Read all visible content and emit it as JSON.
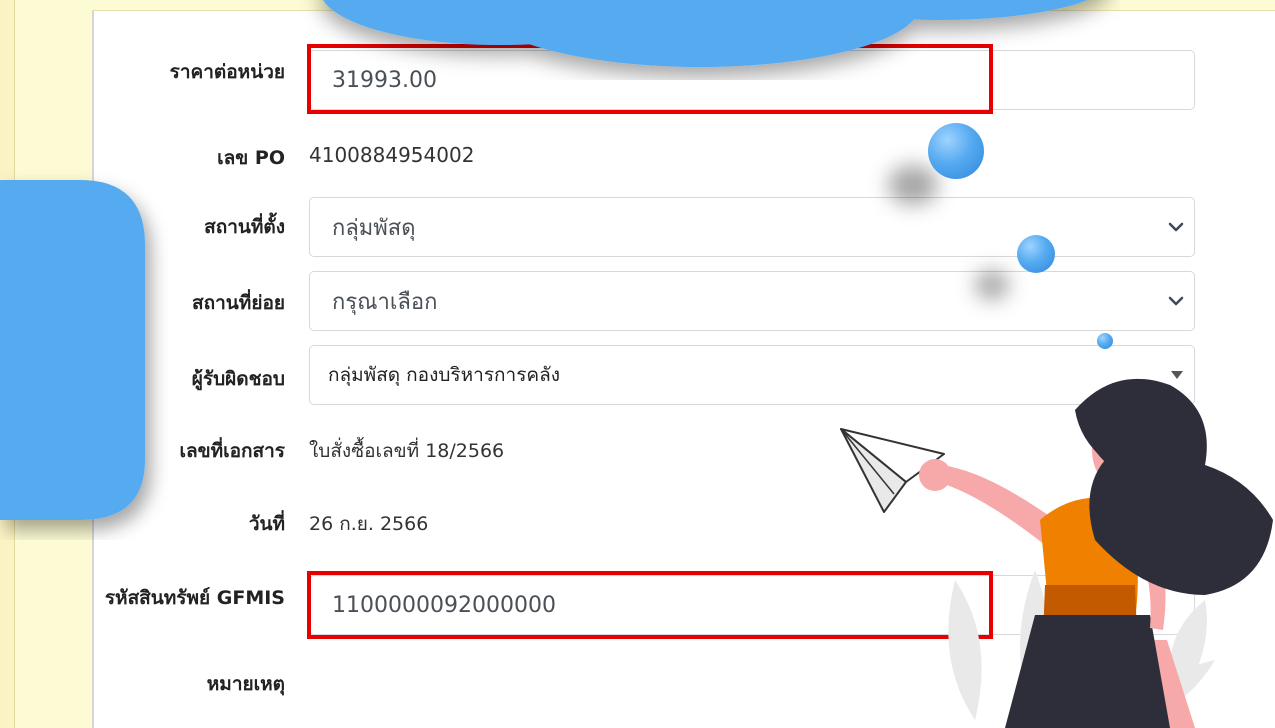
{
  "form": {
    "unit_price": {
      "label": "ราคาต่อหน่วย",
      "value": "31993.00"
    },
    "po_number": {
      "label": "เลข PO",
      "value": "4100884954002"
    },
    "location": {
      "label": "สถานที่ตั้ง",
      "value": "กลุ่มพัสดุ"
    },
    "sub_location": {
      "label": "สถานที่ย่อย",
      "value": "กรุณาเลือก"
    },
    "responsible": {
      "label": "ผู้รับผิดชอบ",
      "value": "กลุ่มพัสดุ กองบริหารการคลัง"
    },
    "document_number": {
      "label": "เลขที่เอกสาร",
      "value": "ใบสั่งซื้อเลขที่ 18/2566"
    },
    "date": {
      "label": "วันที่",
      "value": "26 ก.ย. 2566"
    },
    "gfmis_code": {
      "label": "รหัสสินทรัพย์ GFMIS",
      "value": "1100000092000000"
    },
    "remarks": {
      "label": "หมายเหตุ",
      "value": ""
    }
  },
  "icons": {
    "select_arrow": "chevron-down-icon"
  },
  "colors": {
    "highlight": "#e60000",
    "cloud": "#55aaf0",
    "background": "#fdfbd3"
  }
}
